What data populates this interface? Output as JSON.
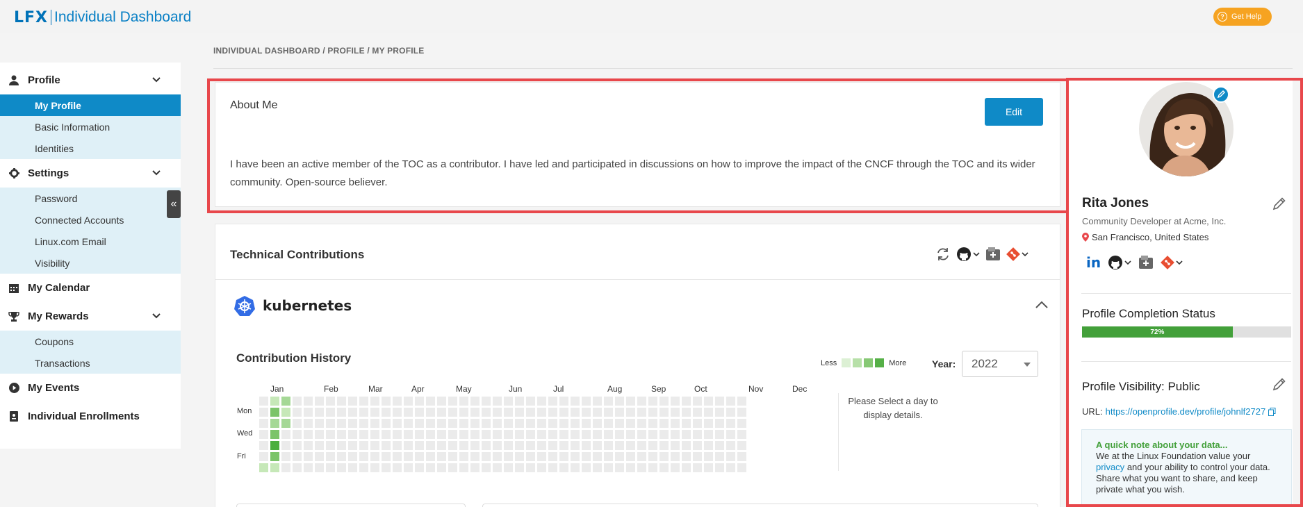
{
  "header": {
    "logo_mark": "LFX",
    "title": "Individual Dashboard",
    "help_label": "Get Help"
  },
  "sidebar": {
    "sections": [
      {
        "label": "Profile",
        "icon": "user-icon",
        "items": [
          "My Profile",
          "Basic Information",
          "Identities"
        ]
      },
      {
        "label": "Settings",
        "icon": "gear-icon",
        "items": [
          "Password",
          "Connected Accounts",
          "Linux.com Email",
          "Visibility"
        ]
      },
      {
        "label": "My Calendar",
        "icon": "calendar-icon",
        "items": []
      },
      {
        "label": "My Rewards",
        "icon": "trophy-icon",
        "items": [
          "Coupons",
          "Transactions"
        ]
      },
      {
        "label": "My Events",
        "icon": "play-circle-icon",
        "items": []
      },
      {
        "label": "Individual Enrollments",
        "icon": "badge-icon",
        "items": []
      }
    ],
    "active_item": "My Profile",
    "collapse_icon": "double-chevron-left-icon"
  },
  "breadcrumb": "INDIVIDUAL DASHBOARD / PROFILE / MY PROFILE",
  "about": {
    "title": "About Me",
    "edit_label": "Edit",
    "text": "I have been an active member of the TOC as a contributor. I have led and participated in discussions on how to improve the impact of the CNCF through the TOC and its wider community. Open-source believer."
  },
  "contributions": {
    "title": "Technical Contributions",
    "project": "kubernetes",
    "history_title": "Contribution History",
    "legend_less": "Less",
    "legend_more": "More",
    "year_label": "Year:",
    "year_value": "2022",
    "months": [
      "Jan",
      "Feb",
      "Mar",
      "Apr",
      "May",
      "Jun",
      "Jul",
      "Aug",
      "Sep",
      "Oct",
      "Nov",
      "Dec"
    ],
    "day_labels": [
      "Mon",
      "Wed",
      "Fri"
    ],
    "select_day_hint": "Please Select a day to display details.",
    "colors": {
      "empty": "#ebebeb",
      "level1": "#c6e8b8",
      "level2": "#a5d896",
      "level3": "#7cc46a",
      "level4": "#4caf3f"
    }
  },
  "profile": {
    "name": "Rita Jones",
    "role": "Community Developer at Acme, Inc.",
    "location": "San Francisco, United States",
    "completion_title": "Profile Completion Status",
    "completion_label": "72%",
    "completion_value": 0.72,
    "visibility_title": "Profile Visibility: Public",
    "url_label": "URL:",
    "url": "https://openprofile.dev/profile/johnlf2727",
    "note_title": "A quick note about your data...",
    "note_pre": "We at the Linux Foundation value your",
    "note_link": "privacy",
    "note_post": "and your ability to control your data. Share what you want to share, and keep private what you wish."
  },
  "colors": {
    "accent": "#0f8ac7",
    "highlight": "#e8474b",
    "progress": "#43a03a",
    "help": "#f6a321"
  }
}
